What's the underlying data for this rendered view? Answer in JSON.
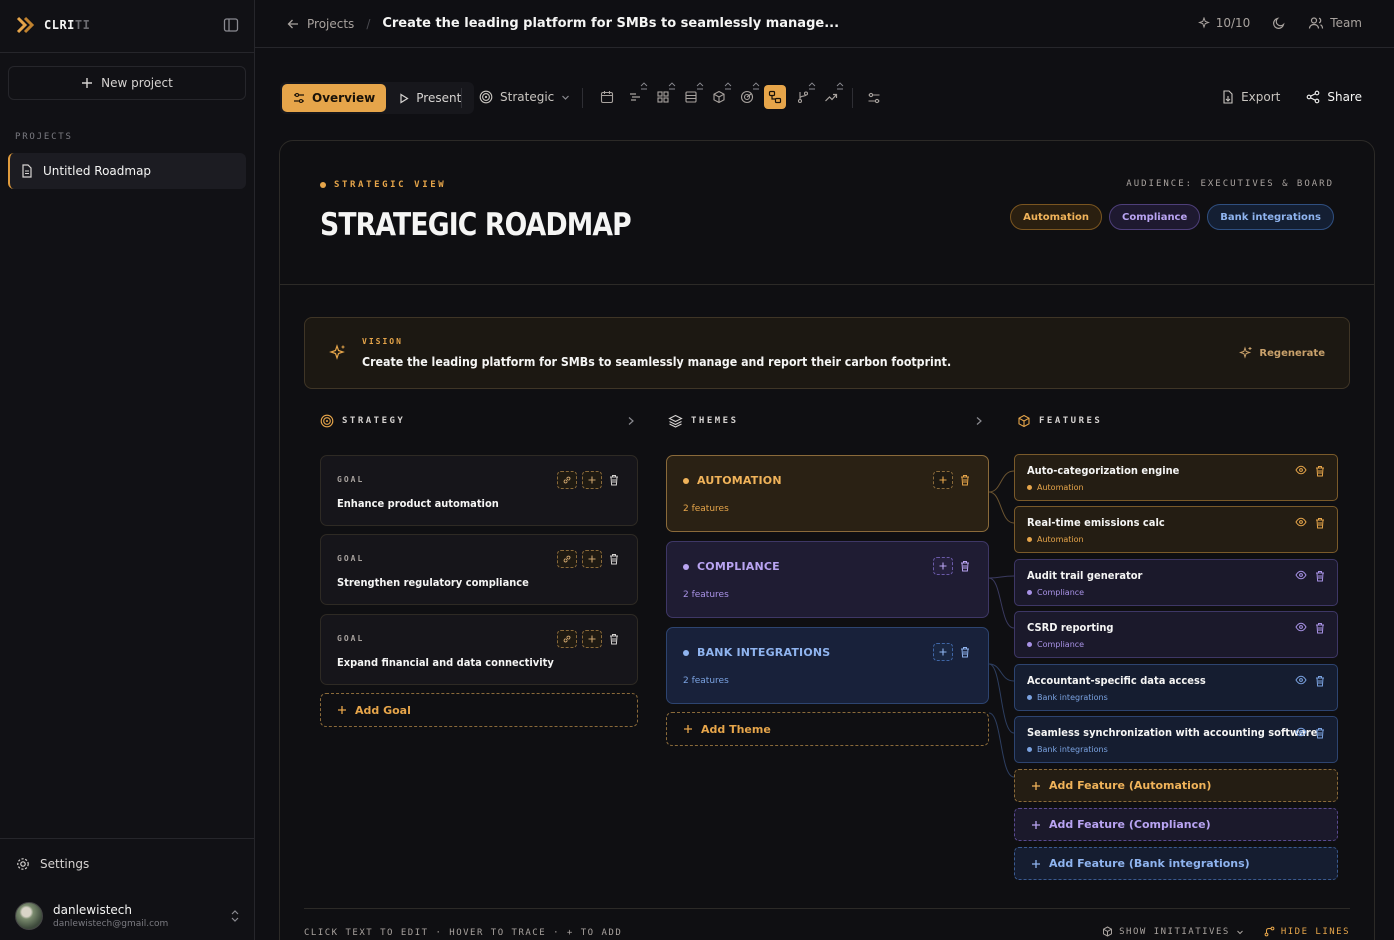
{
  "app": {
    "logo_text_main": "CLRI",
    "logo_text_dim": "TI"
  },
  "sidebar": {
    "new_project_label": "New project",
    "section_label": "PROJECTS",
    "projects": [
      {
        "label": "Untitled Roadmap"
      }
    ],
    "settings_label": "Settings",
    "user": {
      "name": "danlewistech",
      "email": "danlewistech@gmail.com"
    }
  },
  "header": {
    "back_label": "Projects",
    "separator": "/",
    "title": "Create the leading platform for SMBs to seamlessly manage...",
    "credits": "10/10",
    "team_label": "Team"
  },
  "toolbar": {
    "overview_label": "Overview",
    "present_label": "Present",
    "view_selector": "Strategic",
    "export_label": "Export",
    "share_label": "Share"
  },
  "roadmap": {
    "eyebrow": "STRATEGIC VIEW",
    "title": "STRATEGIC ROADMAP",
    "audience": "AUDIENCE: EXECUTIVES & BOARD",
    "chips": [
      "Automation",
      "Compliance",
      "Bank integrations"
    ],
    "vision": {
      "label": "VISION",
      "text": "Create the leading platform for SMBs to seamlessly manage and report their carbon footprint.",
      "regenerate_label": "Regenerate"
    },
    "columns": {
      "strategy": "STRATEGY",
      "themes": "THEMES",
      "features": "FEATURES"
    },
    "goals": [
      {
        "label": "GOAL",
        "text": "Enhance product automation"
      },
      {
        "label": "GOAL",
        "text": "Strengthen regulatory compliance"
      },
      {
        "label": "GOAL",
        "text": "Expand financial and data connectivity"
      }
    ],
    "add_goal_label": "Add Goal",
    "themes": [
      {
        "name": "AUTOMATION",
        "count": "2 features"
      },
      {
        "name": "COMPLIANCE",
        "count": "2 features"
      },
      {
        "name": "BANK INTEGRATIONS",
        "count": "2 features"
      }
    ],
    "add_theme_label": "Add Theme",
    "features": [
      {
        "name": "Auto-categorization engine",
        "tag": "Automation"
      },
      {
        "name": "Real-time emissions calc",
        "tag": "Automation"
      },
      {
        "name": "Audit trail generator",
        "tag": "Compliance"
      },
      {
        "name": "CSRD reporting",
        "tag": "Compliance"
      },
      {
        "name": "Accountant-specific data access",
        "tag": "Bank integrations"
      },
      {
        "name": "Seamless synchronization with accounting software",
        "tag": "Bank integrations"
      }
    ],
    "add_feature_labels": [
      "Add Feature (Automation)",
      "Add Feature (Compliance)",
      "Add Feature (Bank integrations)"
    ],
    "footer": {
      "hint": "CLICK TEXT TO EDIT · HOVER TO TRACE · + TO ADD",
      "initiatives_label": "SHOW INITIATIVES",
      "lines_label": "HIDE LINES"
    }
  },
  "colors": {
    "accent": "#e6a54a",
    "automation": "#f0b35a",
    "compliance": "#b9a4f2",
    "bank": "#8fb4ef"
  }
}
